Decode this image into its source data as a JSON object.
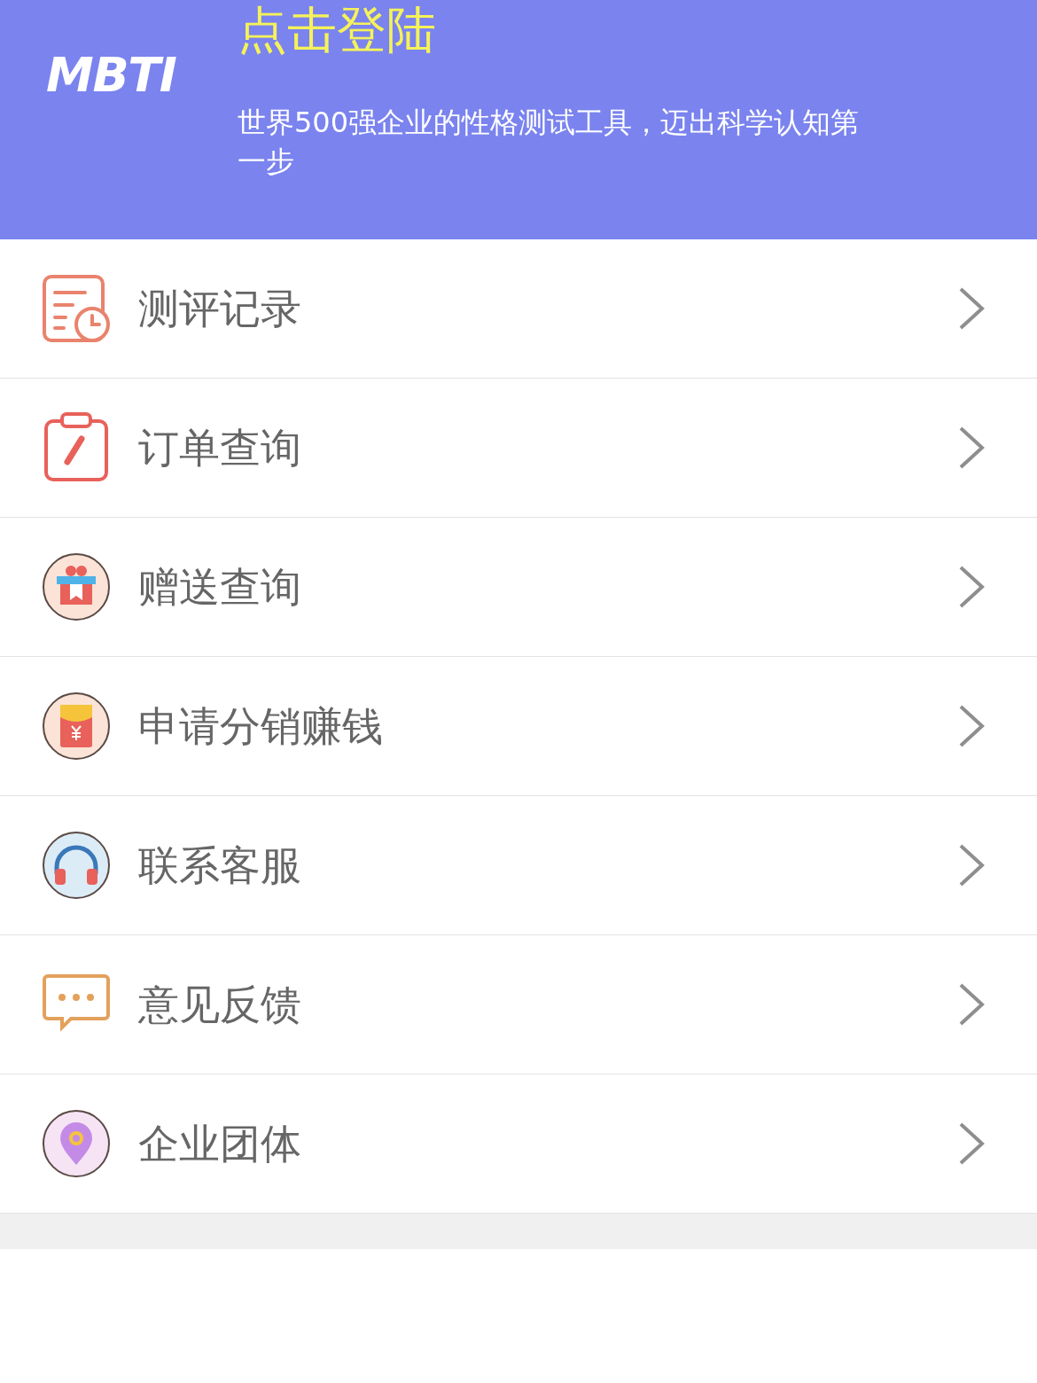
{
  "header": {
    "logo": "MBTI",
    "title": "点击登陆",
    "subtitle": "世界500强企业的性格测试工具，迈出科学认知第一步"
  },
  "menu": [
    {
      "kind": "record",
      "label": "测评记录"
    },
    {
      "kind": "clipboard",
      "label": "订单查询"
    },
    {
      "kind": "gift",
      "label": "赠送查询"
    },
    {
      "kind": "redpacket",
      "label": "申请分销赚钱"
    },
    {
      "kind": "headset",
      "label": "联系客服"
    },
    {
      "kind": "chat",
      "label": "意见反馈"
    },
    {
      "kind": "location",
      "label": "企业团体"
    }
  ]
}
